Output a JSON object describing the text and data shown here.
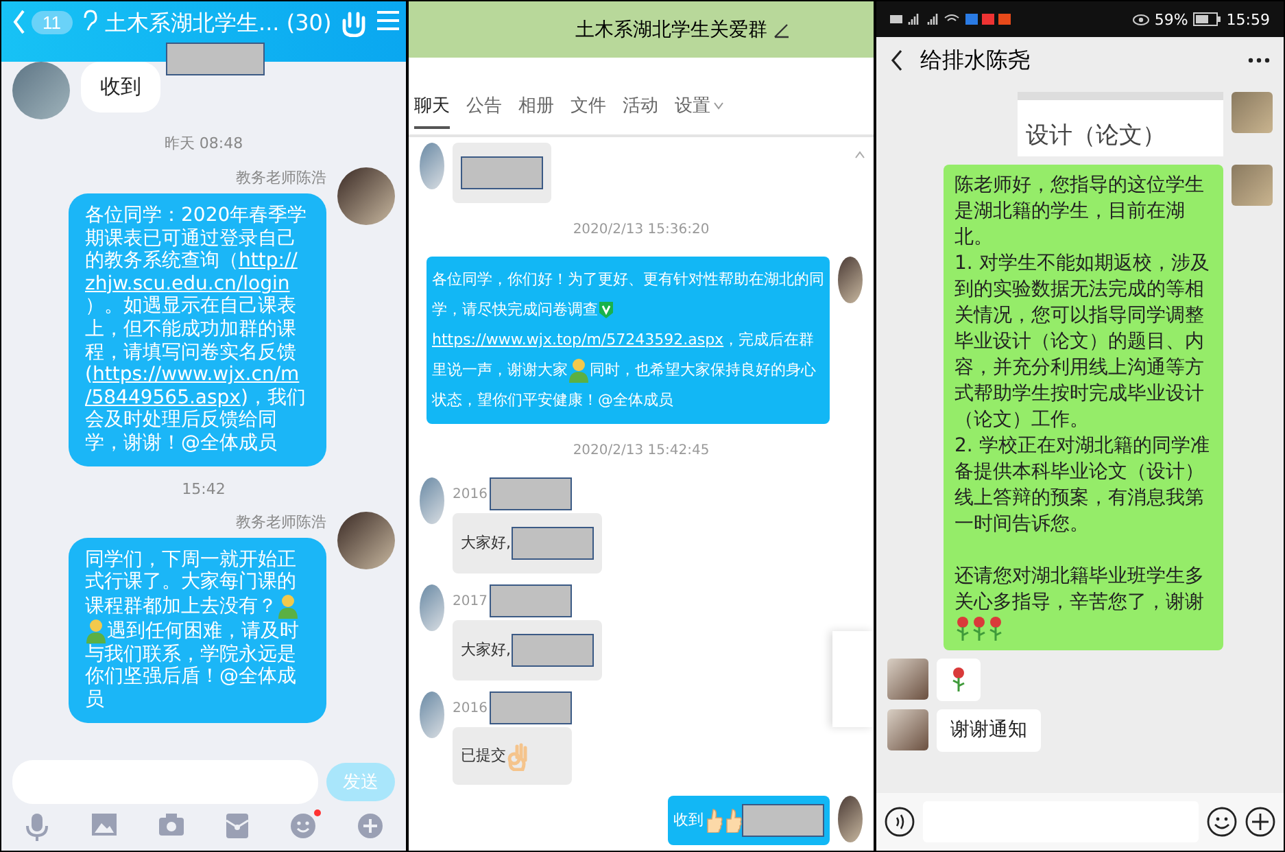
{
  "qq_mobile": {
    "back_count": "11",
    "title": "土木系湖北学生... (30)",
    "messages": [
      {
        "kind": "incoming",
        "segments": [
          {
            "kind": "text",
            "text": "收到"
          }
        ]
      },
      {
        "kind": "time",
        "text": "昨天 08:48"
      },
      {
        "kind": "outgoing",
        "sender": "教务老师陈浩",
        "segments": [
          {
            "kind": "text",
            "text": "各位同学：2020年春季学期课表已可通过登录自己的教务系统查询（"
          },
          {
            "kind": "link",
            "text": "http://"
          },
          {
            "kind": "link",
            "text": "zhjw.scu.edu.cn/login"
          },
          {
            "kind": "text",
            "text": "）。如遇显示在自己课表上，但不能成功加群的课程，请填写问卷实名反馈("
          },
          {
            "kind": "link",
            "text": "https://www.wjx.cn/m"
          },
          {
            "kind": "link",
            "text": "/58449565.aspx"
          },
          {
            "kind": "text",
            "text": ")，我们会及时处理后反馈给同学，谢谢！@全体成员"
          }
        ]
      },
      {
        "kind": "time",
        "text": "15:42"
      },
      {
        "kind": "outgoing",
        "sender": "教务老师陈浩",
        "segments": [
          {
            "kind": "text",
            "text": "同学们，下周一就开始正式行课了。大家每门课的课程群都加上去没有？"
          },
          {
            "kind": "figure"
          },
          {
            "kind": "figure"
          },
          {
            "kind": "text",
            "text": "遇到任何困难，请及时与我们联系，学院永远是你们坚强后盾！@全体成员"
          }
        ]
      }
    ],
    "send_button": {
      "label": "发送",
      "disabled": true
    },
    "toolbar": [
      {
        "kind": "mic",
        "dot": false
      },
      {
        "kind": "image",
        "dot": false
      },
      {
        "kind": "camera",
        "dot": false
      },
      {
        "kind": "envelope",
        "dot": false
      },
      {
        "kind": "emoji",
        "dot": true
      },
      {
        "kind": "plus",
        "dot": false
      }
    ]
  },
  "qq_desktop": {
    "title": "土木系湖北学生关爱群",
    "tabs": [
      {
        "label": "聊天",
        "selected": true,
        "dropdown": false
      },
      {
        "label": "公告",
        "selected": false,
        "dropdown": false
      },
      {
        "label": "相册",
        "selected": false,
        "dropdown": false
      },
      {
        "label": "文件",
        "selected": false,
        "dropdown": false
      },
      {
        "label": "活动",
        "selected": false,
        "dropdown": false
      },
      {
        "label": "设置",
        "selected": false,
        "dropdown": true
      }
    ],
    "messages": [
      {
        "kind": "incoming",
        "segments": [
          {
            "kind": "redacted"
          }
        ]
      },
      {
        "kind": "time",
        "text": "2020/2/13 15:36:20"
      },
      {
        "kind": "outgoing",
        "segments": [
          {
            "kind": "text",
            "text": "各位同学，你们好！为了更好、更有针对性帮助在湖北的同学，请尽快完成问卷调查"
          },
          {
            "kind": "check"
          },
          {
            "kind": "link",
            "text": "https://www.wjx.top/m/57243592.aspx"
          },
          {
            "kind": "text",
            "text": "，完成后在群里说一声，谢谢大家"
          },
          {
            "kind": "figure"
          },
          {
            "kind": "text",
            "text": "同时，也希望大家保持良好的身心状态，望你们平安健康！@全体成员"
          }
        ]
      },
      {
        "kind": "time",
        "text": "2020/2/13 15:42:45"
      },
      {
        "kind": "incoming",
        "sender": "2016",
        "segments": [
          {
            "kind": "text",
            "text": "大家好,"
          },
          {
            "kind": "redacted"
          }
        ]
      },
      {
        "kind": "incoming",
        "sender": "2017",
        "segments": [
          {
            "kind": "text",
            "text": "大家好,"
          },
          {
            "kind": "redacted"
          }
        ]
      },
      {
        "kind": "incoming",
        "sender": "2016",
        "segments": [
          {
            "kind": "text",
            "text": "已提交"
          },
          {
            "kind": "okhand"
          }
        ]
      },
      {
        "kind": "outgoing",
        "segments": [
          {
            "kind": "text",
            "text": "收到"
          },
          {
            "kind": "thumb"
          },
          {
            "kind": "thumb"
          },
          {
            "kind": "redacted"
          }
        ]
      }
    ]
  },
  "wechat": {
    "battery": "59%",
    "clock": "15:59",
    "title": "给排水陈尧",
    "messages": [
      {
        "kind": "image",
        "text": "设计（论文）"
      },
      {
        "kind": "outgoing",
        "paragraphs": [
          {
            "kind": "text",
            "segments": [
              {
                "kind": "text",
                "text": "陈老师好，您指导的这位学生是湖北籍的学生，目前在湖北。"
              }
            ]
          },
          {
            "kind": "text",
            "segments": [
              {
                "kind": "text",
                "text": "1. 对学生不能如期返校，涉及到的实验数据无法完成的等相关情况，您可以指导同学调整毕业设计（论文）的题目、内容，并充分利用线上沟通等方式帮助学生按时完成毕业设计（论文）工作。"
              }
            ]
          },
          {
            "kind": "text",
            "segments": [
              {
                "kind": "text",
                "text": "2. 学校正在对湖北籍的同学准备提供本科毕业论文（设计）线上答辩的预案，有消息我第一时间告诉您。"
              }
            ]
          },
          {
            "kind": "blank"
          },
          {
            "kind": "text",
            "segments": [
              {
                "kind": "text",
                "text": "还请您对湖北籍毕业班学生多关心多指导，辛苦您了，谢谢"
              },
              {
                "kind": "rose"
              },
              {
                "kind": "rose"
              },
              {
                "kind": "rose"
              }
            ]
          }
        ]
      },
      {
        "kind": "incoming",
        "segments": [
          {
            "kind": "rose"
          }
        ]
      },
      {
        "kind": "incoming",
        "segments": [
          {
            "kind": "text",
            "text": "谢谢通知"
          }
        ]
      }
    ]
  }
}
